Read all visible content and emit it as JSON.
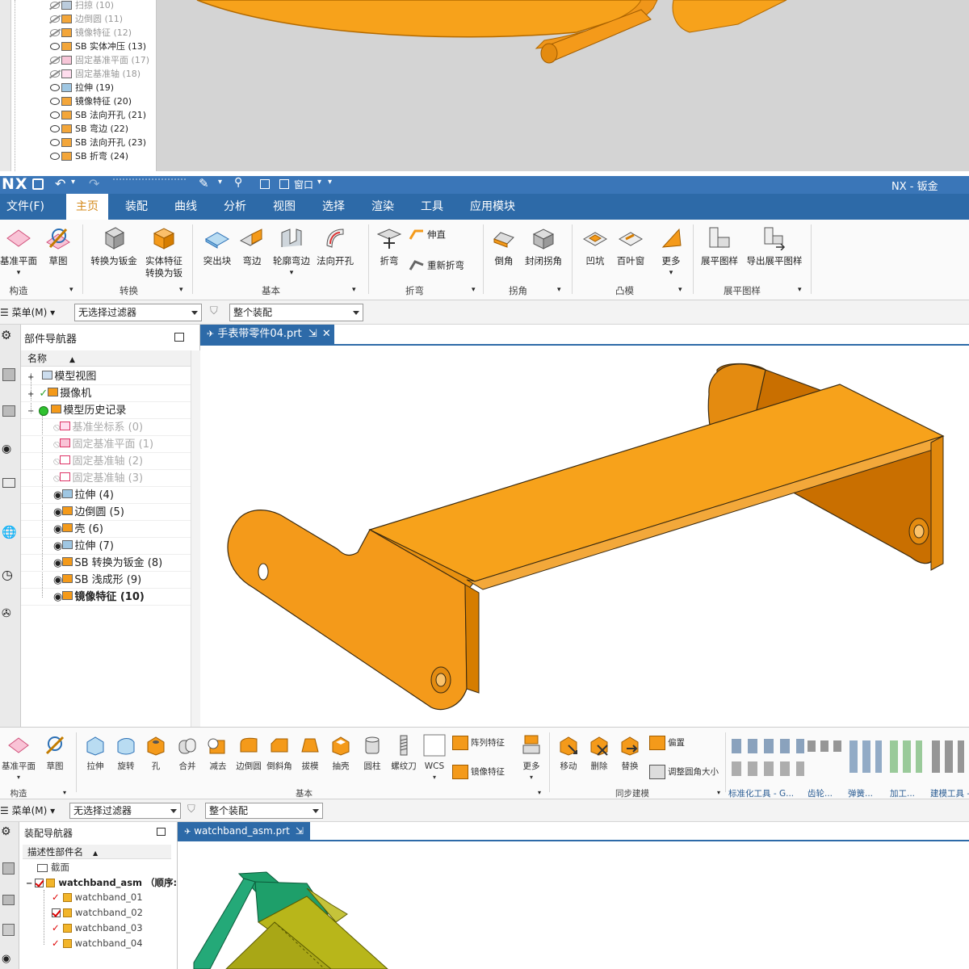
{
  "top_tree": {
    "items": [
      {
        "label": "扫掠 (10)",
        "dim": true
      },
      {
        "label": "边倒圆 (11)",
        "dim": true
      },
      {
        "label": "镜像特征 (12)",
        "dim": true
      },
      {
        "label": "SB 实体冲压 (13)",
        "dim": false
      },
      {
        "label": "固定基准平面 (17)",
        "dim": true
      },
      {
        "label": "固定基准轴 (18)",
        "dim": true
      },
      {
        "label": "拉伸 (19)",
        "dim": false
      },
      {
        "label": "镜像特征 (20)",
        "dim": false
      },
      {
        "label": "SB 法向开孔 (21)",
        "dim": false
      },
      {
        "label": "SB 弯边 (22)",
        "dim": false
      },
      {
        "label": "SB 法向开孔 (23)",
        "dim": false
      },
      {
        "label": "SB 折弯 (24)",
        "dim": false
      }
    ]
  },
  "titlebar": {
    "logo": "NX",
    "window_menu": "窗口",
    "app_title": "NX - 钣金"
  },
  "menu": {
    "items": [
      "文件(F)",
      "主页",
      "装配",
      "曲线",
      "分析",
      "视图",
      "选择",
      "渲染",
      "工具",
      "应用模块"
    ]
  },
  "ribbon": {
    "buttons": [
      "基准平面",
      "草图",
      "转换为钣金",
      "实体特征\n转换为钣",
      "突出块",
      "弯边",
      "轮廓弯边",
      "法向开孔",
      "折弯",
      "倒角",
      "封闭拐角",
      "凹坑",
      "百叶窗",
      "更多",
      "展平图样",
      "导出展平图样"
    ],
    "small": [
      "伸直",
      "重新折弯"
    ],
    "groups": [
      "构造",
      "转换",
      "基本",
      "折弯",
      "拐角",
      "凸模",
      "展平图样"
    ]
  },
  "filter": {
    "menu_label": "菜单(M)",
    "type_filter": "无选择过滤器",
    "scope": "整个装配"
  },
  "part_navigator": {
    "title": "部件导航器",
    "column": "名称",
    "nodes": [
      {
        "label": "模型视图",
        "dim": false,
        "bold": false
      },
      {
        "label": "摄像机",
        "dim": false,
        "bold": false
      },
      {
        "label": "模型历史记录",
        "dim": false,
        "bold": false
      },
      {
        "label": "基准坐标系 (0)",
        "dim": true,
        "bold": false
      },
      {
        "label": "固定基准平面 (1)",
        "dim": true,
        "bold": false
      },
      {
        "label": "固定基准轴 (2)",
        "dim": true,
        "bold": false
      },
      {
        "label": "固定基准轴 (3)",
        "dim": true,
        "bold": false
      },
      {
        "label": "拉伸 (4)",
        "dim": false,
        "bold": false
      },
      {
        "label": "边倒圆 (5)",
        "dim": false,
        "bold": false
      },
      {
        "label": "壳 (6)",
        "dim": false,
        "bold": false
      },
      {
        "label": "拉伸 (7)",
        "dim": false,
        "bold": false
      },
      {
        "label": "SB 转换为钣金 (8)",
        "dim": false,
        "bold": false
      },
      {
        "label": "SB 浅成形 (9)",
        "dim": false,
        "bold": false
      },
      {
        "label": "镜像特征 (10)",
        "dim": false,
        "bold": true
      }
    ]
  },
  "tab1": {
    "label": "手表带零件04.prt"
  },
  "ribbon2": {
    "buttons": [
      "基准平面",
      "草图",
      "拉伸",
      "旋转",
      "孔",
      "合并",
      "减去",
      "边倒圆",
      "倒斜角",
      "拔模",
      "抽壳",
      "圆柱",
      "螺纹刀",
      "WCS",
      "更多",
      "移动",
      "删除",
      "替换"
    ],
    "small": [
      "阵列特征",
      "镜像特征",
      "偏置",
      "调整圆角大小"
    ],
    "groups": [
      "构造",
      "基本",
      "同步建模",
      "标准化工具 - G...",
      "齿轮...",
      "弹簧...",
      "加工...",
      "建模工具 -"
    ]
  },
  "filter2": {
    "menu_label": "菜单(M)",
    "type_filter": "无选择过滤器",
    "scope": "整个装配"
  },
  "assembly_navigator": {
    "title": "装配导航器",
    "column": "描述性部件名",
    "section": "截面",
    "root": "watchband_asm",
    "root_suffix": "（顺序:",
    "parts": [
      "watchband_01",
      "watchband_02",
      "watchband_03",
      "watchband_04"
    ]
  },
  "tab2": {
    "label": "watchband_asm.prt"
  },
  "colors": {
    "title_blue": "#3a76b8",
    "menu_blue": "#2d6aa8",
    "part_orange": "#f7a21b",
    "accent_orange": "#d4891a"
  }
}
